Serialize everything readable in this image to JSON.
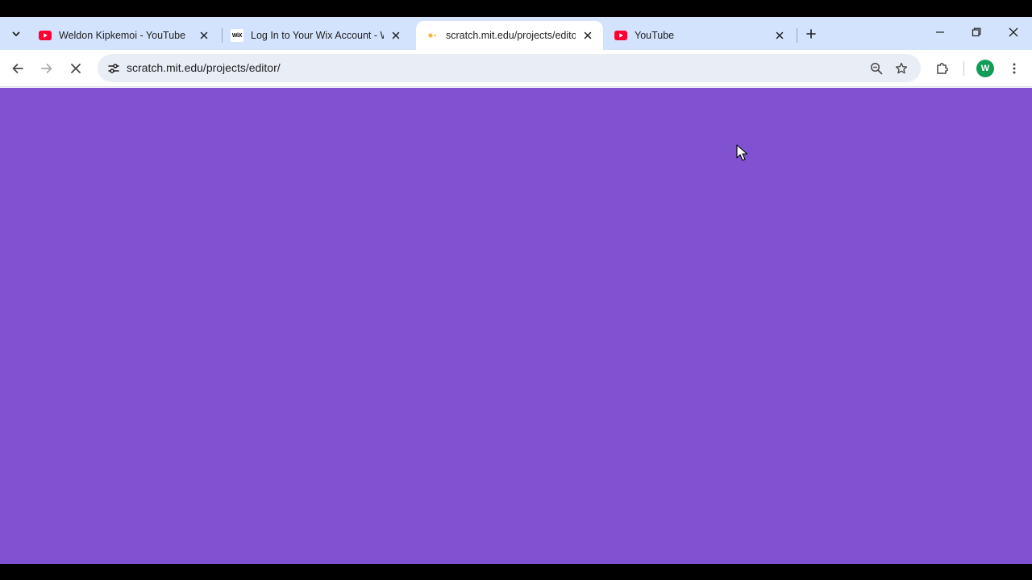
{
  "tabs": [
    {
      "title": "Weldon Kipkemoi - YouTube",
      "favicon": "youtube-icon",
      "active": false
    },
    {
      "title": "Log In to Your Wix Account - W",
      "favicon": "wix-icon",
      "active": false
    },
    {
      "title": "scratch.mit.edu/projects/editor/",
      "favicon": "loading-favicon-icon",
      "active": true
    },
    {
      "title": "YouTube",
      "favicon": "youtube-icon",
      "active": false
    }
  ],
  "wix_favicon_text": "WiX",
  "address_bar": {
    "url": "scratch.mit.edu/projects/editor/"
  },
  "profile": {
    "initial": "W"
  },
  "colors": {
    "tabstrip": "#d3e3fd",
    "page_background": "#8052d2",
    "youtube_red": "#ff0033",
    "avatar_green": "#0f9d58"
  }
}
